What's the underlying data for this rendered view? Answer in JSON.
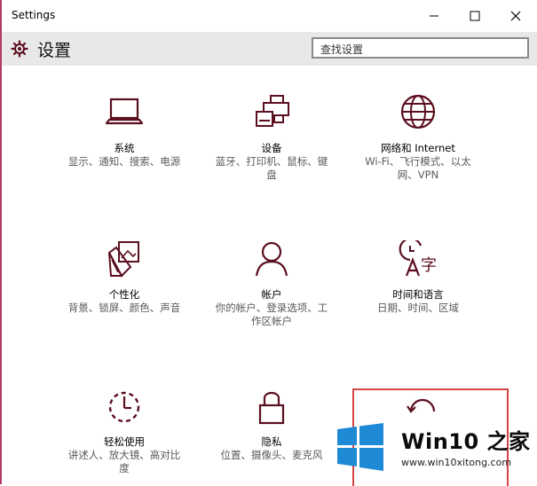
{
  "window": {
    "title": "Settings"
  },
  "header": {
    "title": "设置",
    "search_placeholder": "查找设置"
  },
  "tiles": [
    {
      "name": "系统",
      "desc": "显示、通知、搜索、电源",
      "icon": "laptop-icon"
    },
    {
      "name": "设备",
      "desc": "蓝牙、打印机、鼠标、键盘",
      "icon": "devices-icon"
    },
    {
      "name": "网络和 Internet",
      "desc": "Wi-Fi、飞行模式、以太网、VPN",
      "icon": "globe-icon"
    },
    {
      "name": "个性化",
      "desc": "背景、锁屏、颜色、声音",
      "icon": "personalization-icon"
    },
    {
      "name": "帐户",
      "desc": "你的帐户、登录选项、工作区帐户",
      "icon": "person-icon"
    },
    {
      "name": "时间和语言",
      "desc": "日期、时间、区域",
      "icon": "time-language-icon"
    },
    {
      "name": "轻松使用",
      "desc": "讲述人、放大镜、高对比度",
      "icon": "ease-of-access-icon"
    },
    {
      "name": "隐私",
      "desc": "位置、摄像头、麦克风",
      "icon": "lock-icon"
    }
  ],
  "watermark": {
    "title": "Win10 之家",
    "url": "www.win10xitong.com"
  },
  "colors": {
    "accent": "#5b0f1f",
    "header_bg": "#e8e8e8",
    "focus_border": "#d64545",
    "win_blue": "#1e8ad6"
  }
}
